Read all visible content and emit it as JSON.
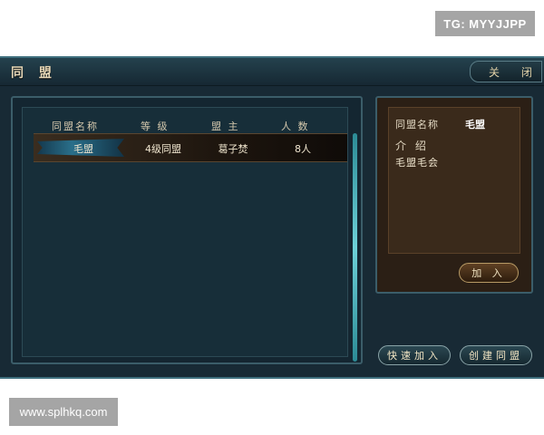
{
  "watermarks": {
    "top": "TG: MYYJJPP",
    "bottom": "www.splhkq.com"
  },
  "window": {
    "title": "同 盟",
    "close_label": "关 闭"
  },
  "list": {
    "headers": [
      "同盟名称",
      "等 级",
      "盟 主",
      "人 数"
    ],
    "rows": [
      {
        "name": "毛盟",
        "level": "4级同盟",
        "leader": "葛子焚",
        "members": "8人"
      }
    ]
  },
  "info": {
    "name_label": "同盟名称",
    "name_value": "毛盟",
    "intro_label": "介 绍",
    "intro_text": "毛盟毛会",
    "join_button": "加 入"
  },
  "buttons": {
    "quick_join": "快速加入",
    "create": "创建同盟"
  }
}
